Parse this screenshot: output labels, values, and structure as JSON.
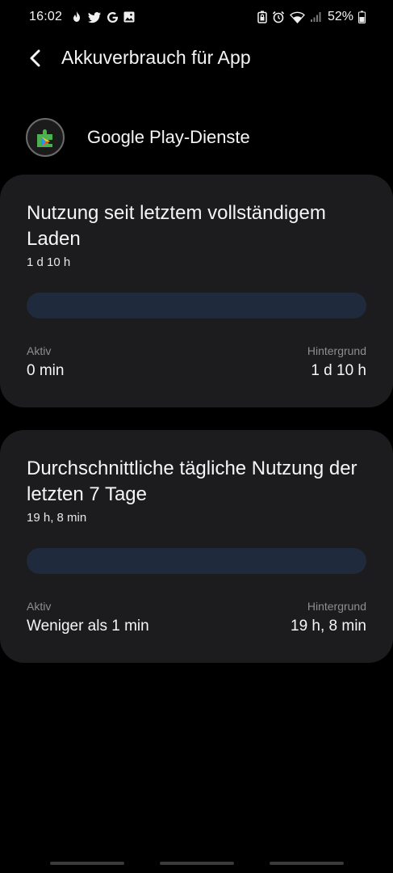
{
  "status_bar": {
    "time": "16:02",
    "battery_percent": "52%",
    "left_icons": [
      "fire-icon",
      "twitter-icon",
      "google-icon",
      "image-icon"
    ],
    "right_icons": [
      "lock-battery-icon",
      "alarm-icon",
      "wifi-icon",
      "signal-icon",
      "battery-icon"
    ]
  },
  "header": {
    "title": "Akkuverbrauch für App"
  },
  "app": {
    "name": "Google Play-Dienste",
    "icon": "google-play-services-icon"
  },
  "cards": [
    {
      "title": "Nutzung seit letztem vollständigem Laden",
      "subtitle": "1 d 10 h",
      "active_fraction": 0,
      "active_label": "Aktiv",
      "active_value": "0 min",
      "background_label": "Hintergrund",
      "background_value": "1 d 10 h"
    },
    {
      "title": "Durchschnittliche tägliche Nutzung der letzten 7 Tage",
      "subtitle": "19 h, 8 min",
      "active_fraction": 0,
      "active_label": "Aktiv",
      "active_value": "Weniger als 1 min",
      "background_label": "Hintergrund",
      "background_value": "19 h, 8 min"
    }
  ],
  "colors": {
    "background": "#000000",
    "card": "#1c1c1e",
    "bar_track": "#1f2b3d",
    "muted_text": "#8e8e8e"
  }
}
